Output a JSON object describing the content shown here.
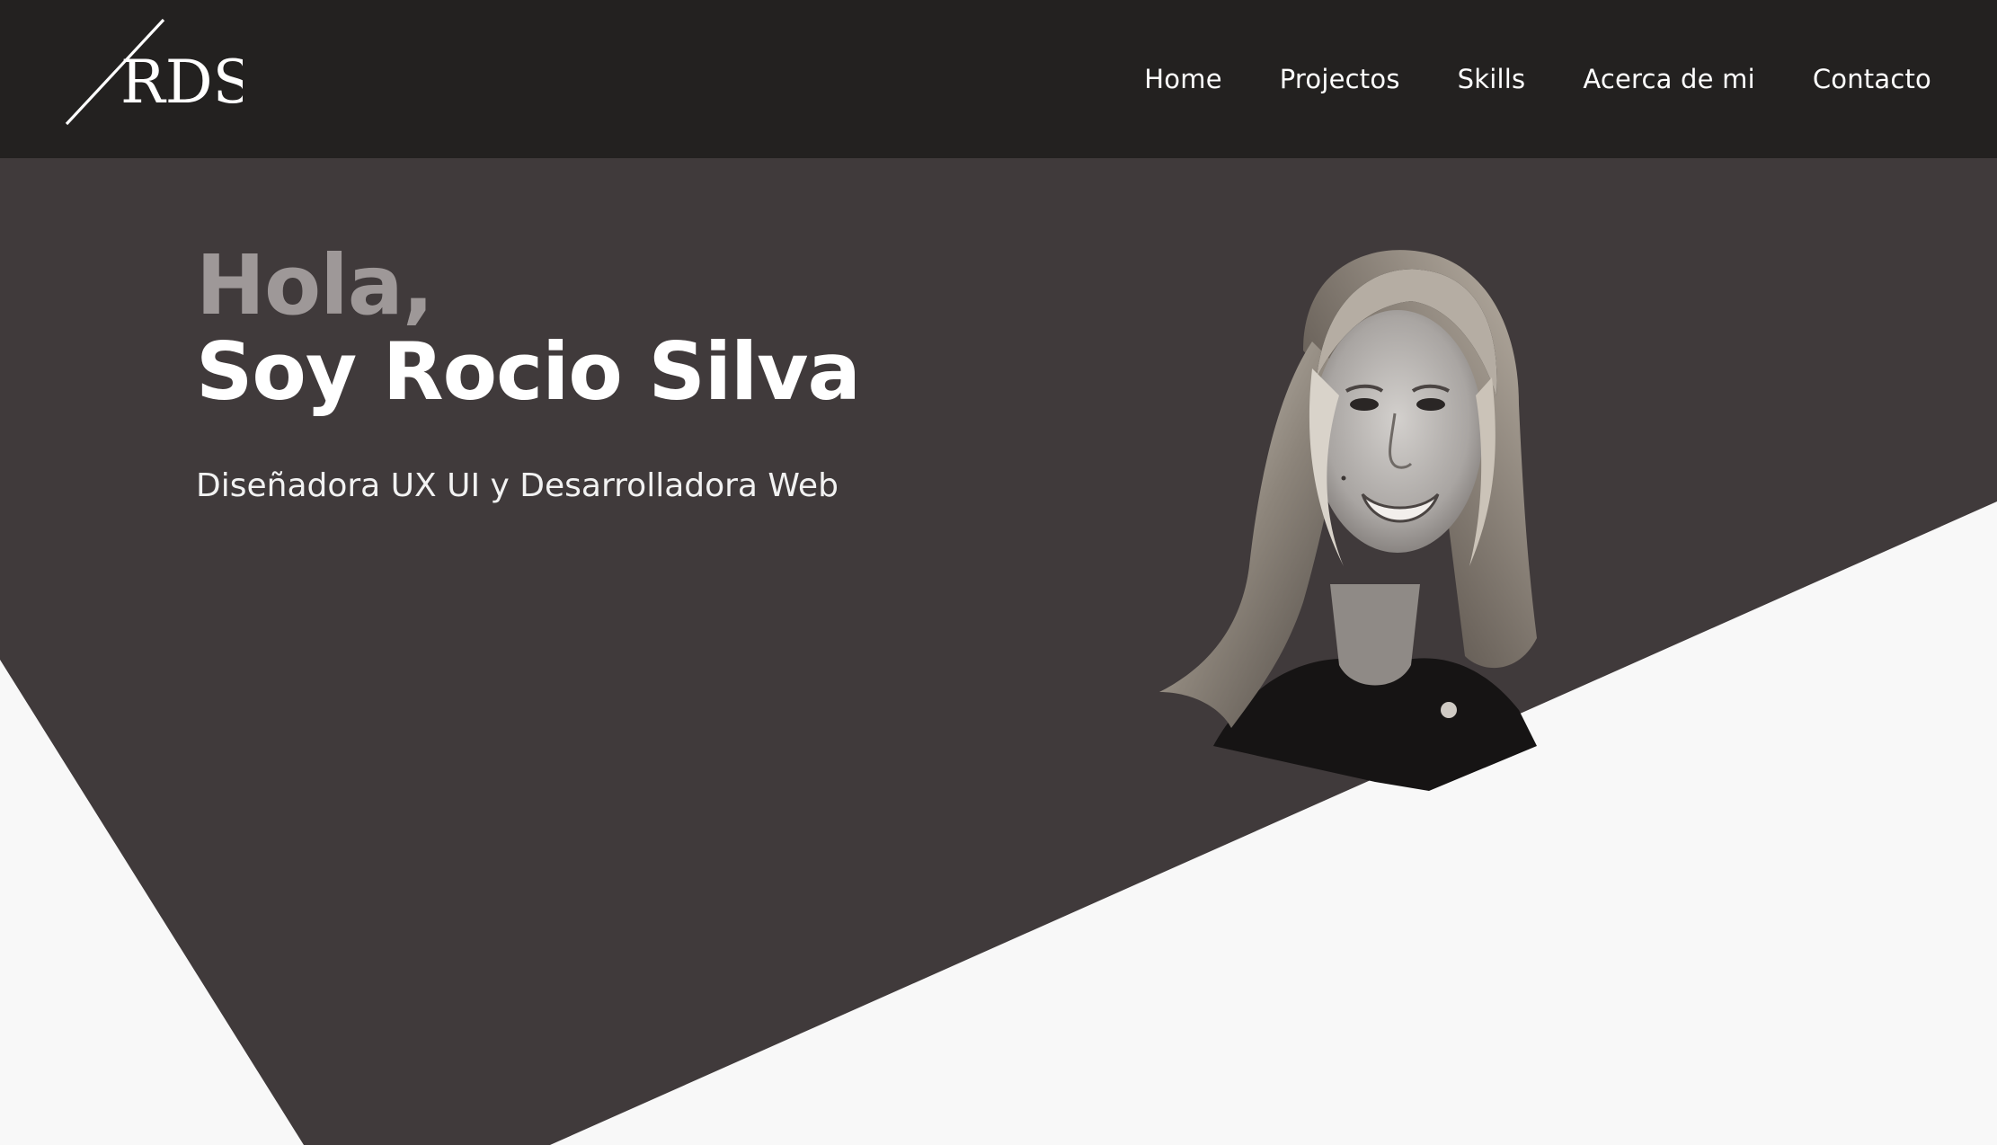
{
  "brand": {
    "logo_text": "RDS"
  },
  "nav": {
    "items": [
      {
        "label": "Home"
      },
      {
        "label": "Projectos"
      },
      {
        "label": "Skills"
      },
      {
        "label": "Acerca de mi"
      },
      {
        "label": "Contacto"
      }
    ]
  },
  "hero": {
    "greeting": "Hola,",
    "name": "Soy Rocio Silva",
    "role": "Diseñadora UX UI y Desarrolladora Web"
  },
  "colors": {
    "header_bg": "#232120",
    "hero_bg": "#403a3b",
    "page_bg": "#f8f8f8",
    "greeting": "#9e9898",
    "text": "#ffffff"
  }
}
